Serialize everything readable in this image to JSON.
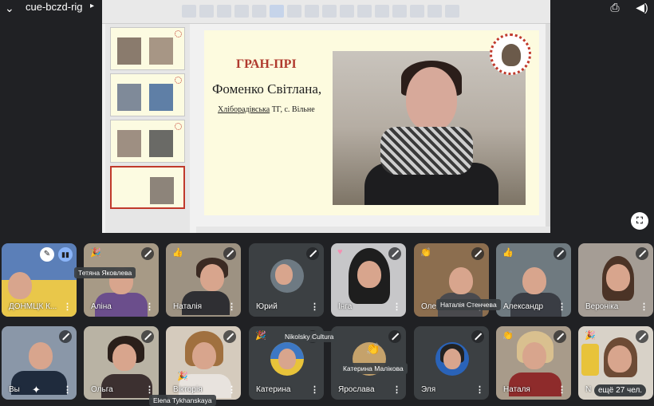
{
  "topbar": {
    "meeting_code": "cue-bczd-rig",
    "chevron_icon": "chevron-down-icon",
    "caret_icon": "caret-right-icon",
    "icons": [
      "camera-flip-icon",
      "speaker-icon"
    ]
  },
  "slide": {
    "award": "ГРАН-ПРІ",
    "name": "Фоменко Світлана,",
    "place_underlined": "Хліборадівська",
    "place_rest": " ТГ, с. Вільне"
  },
  "fullscreen_icon": "fullscreen-icon",
  "participants": [
    {
      "name": "ДОНМЦК К...",
      "icons": [
        "pin-icon",
        "audio-active-icon"
      ]
    },
    {
      "name": "Аліна"
    },
    {
      "name": "Наталія"
    },
    {
      "name": "Юрий"
    },
    {
      "name": "Інга"
    },
    {
      "name": "Оле..."
    },
    {
      "name": "Александр"
    },
    {
      "name": "Вероніка"
    },
    {
      "name": "Вы"
    },
    {
      "name": "Ольга"
    },
    {
      "name": "Вікторія"
    },
    {
      "name": "Катерина"
    },
    {
      "name": "Ярослава"
    },
    {
      "name": "Эля"
    },
    {
      "name": "Наталя"
    },
    {
      "name": "ещё 27 чел.",
      "prefix": "N"
    }
  ],
  "floating_names": {
    "tetiana": "Тетяна Яковлева",
    "natalia_s": "Наталія Стенчева",
    "nikolsky": "Nikolsky Cultura",
    "kateryna_m": "Катерина Малікова",
    "elena": "Elena Tykhanskaya"
  },
  "colors": {
    "background": "#202124",
    "slide_bg": "#fdfbdf",
    "award_red": "#b03a2e"
  }
}
